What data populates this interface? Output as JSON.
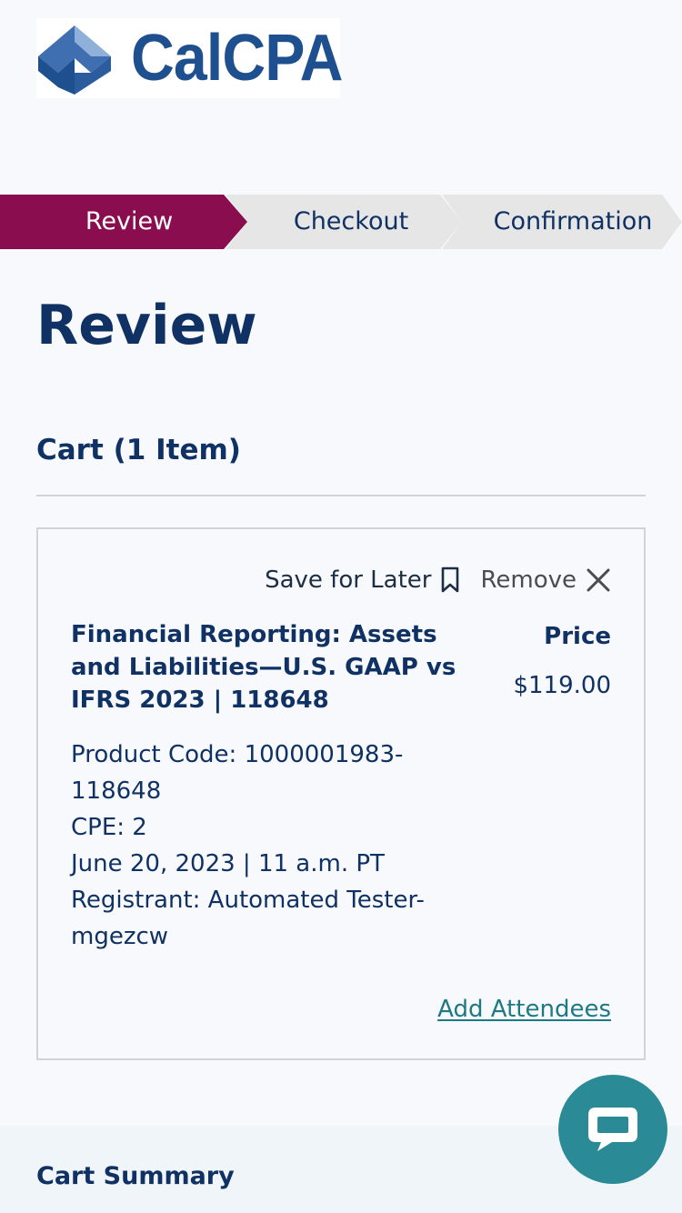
{
  "brand": {
    "name": "CalCPA",
    "logo_colors": {
      "dark_blue": "#1e4f8f",
      "mid_blue": "#3f6fb0",
      "light_blue": "#8fb0d8"
    }
  },
  "steps": [
    {
      "label": "Review",
      "active": true
    },
    {
      "label": "Checkout",
      "active": false
    },
    {
      "label": "Confirmation",
      "active": false
    }
  ],
  "step_colors": {
    "active_bg": "#8a0d4f",
    "inactive_bg": "#e6e6e6"
  },
  "page": {
    "title": "Review",
    "cart_heading": "Cart (1 Item)"
  },
  "cart_item": {
    "actions": {
      "save_for_later": "Save for Later",
      "save_icon": "bookmark-icon",
      "remove": "Remove",
      "remove_icon": "close-icon"
    },
    "title": "Financial Reporting: Assets and Liabilities—U.S. GAAP vs IFRS 2023 | 118648",
    "price_label": "Price",
    "price": "$119.00",
    "details": {
      "product_code": "Product Code: 1000001983-118648",
      "cpe": "CPE: 2",
      "date": "June 20, 2023 | 11 a.m. PT",
      "registrant": "Registrant: Automated Tester-mgezcw"
    },
    "add_attendees": "Add Attendees"
  },
  "summary": {
    "heading": "Cart Summary"
  },
  "chat": {
    "icon": "chat-bubble-icon",
    "color": "#2a8a96"
  }
}
